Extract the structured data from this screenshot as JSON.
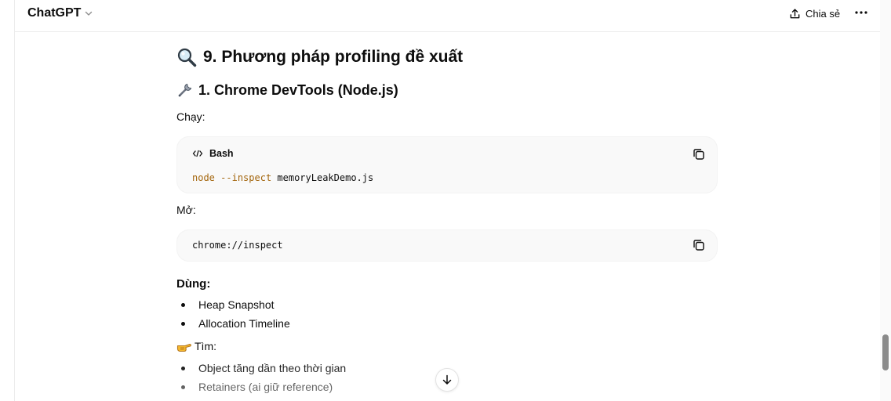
{
  "header": {
    "model_name": "ChatGPT",
    "share_label": "Chia sẻ"
  },
  "content": {
    "section_heading": "9. Phương pháp profiling đề xuất",
    "section_icon": "magnifying-glass",
    "subheading": "1. Chrome DevTools (Node.js)",
    "subheading_icon": "wrench",
    "run_label": "Chạy:",
    "code_block_1": {
      "language": "Bash",
      "cmd": "node",
      "flag": "--inspect",
      "arg": "memoryLeakDemo.js"
    },
    "open_label": "Mở:",
    "code_block_2": {
      "code": "chrome://inspect"
    },
    "use_label": "Dùng:",
    "use_items": [
      "Heap Snapshot",
      "Allocation Timeline"
    ],
    "find_icon": "pointing-hand",
    "find_label": "Tìm:",
    "find_items": [
      "Object tăng dần theo thời gian",
      "Retainers (ai giữ reference)"
    ]
  },
  "colors": {
    "code_background": "#f9f9f9",
    "code_keyword": "#a3650c",
    "text": "#0d0d0d",
    "scroll_thumb": "#8a8a8a"
  }
}
